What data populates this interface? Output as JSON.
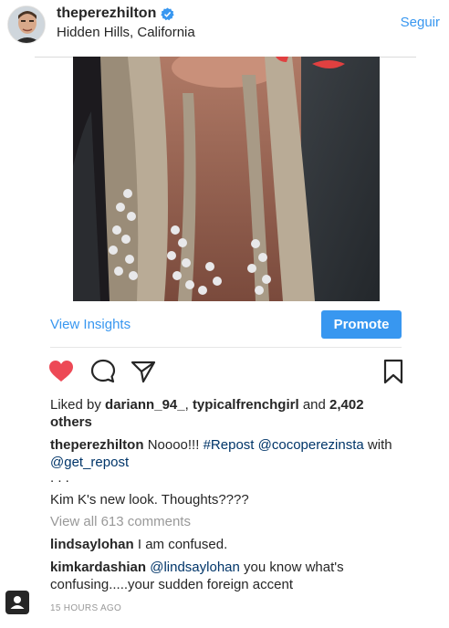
{
  "post": {
    "username": "theperezhilton",
    "location": "Hidden Hills, California",
    "follow_label": "Seguir"
  },
  "insights": {
    "view_label": "View Insights",
    "promote_label": "Promote"
  },
  "likes": {
    "prefix": "Liked by",
    "user1": "dariann_94_",
    "sep": ",",
    "user2": "typicalfrenchgirl",
    "and": "and",
    "count": "2,402",
    "others": "others"
  },
  "caption": {
    "author": "theperezhilton",
    "text1": "Noooo!!!",
    "hashtag": "#Repost",
    "mention1": "@cocoperezinsta",
    "with": "with",
    "mention2": "@get_repost",
    "dots": ". . .",
    "line2": "Kim K's new look. Thoughts????"
  },
  "comments": {
    "view_all": "View all 613 comments",
    "items": [
      {
        "user": "lindsaylohan",
        "text": "I am confused."
      },
      {
        "user": "kimkardashian",
        "mention": "@lindsaylohan",
        "text": "you know what's confusing.....your sudden foreign accent"
      }
    ]
  },
  "timestamp": "15 hours ago",
  "colors": {
    "accent": "#3897f0",
    "heart": "#ed4956",
    "text": "#262626",
    "muted": "#999999",
    "link": "#003569"
  },
  "icons": [
    "verified-badge-icon",
    "heart-filled-icon",
    "comment-icon",
    "share-icon",
    "bookmark-icon",
    "profile-icon"
  ]
}
